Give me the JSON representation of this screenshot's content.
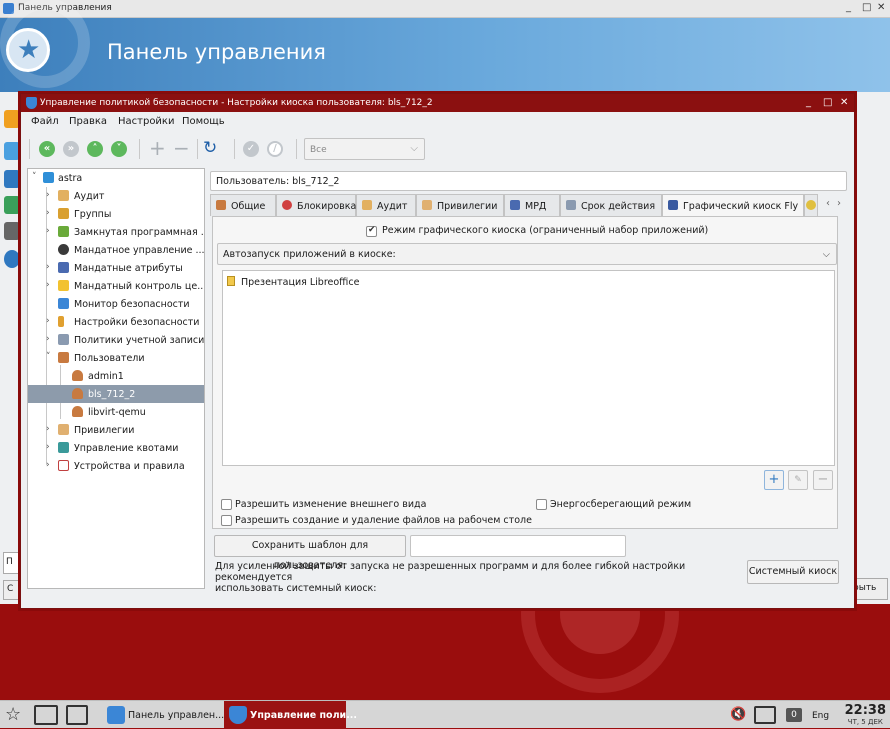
{
  "bg_window": {
    "title": "Панель управления",
    "header_title": "Панель управления",
    "search_fragment": "П",
    "left_button_fragment": "С",
    "open_button_fragment": "рыть"
  },
  "window": {
    "title": "Управление политикой безопасности - Настройки киоска пользователя: bls_712_2",
    "controls": [
      "_",
      "□",
      "✕"
    ]
  },
  "menu": [
    "Файл",
    "Правка",
    "Настройки",
    "Помощь"
  ],
  "toolbar": {
    "filter_value": "Все"
  },
  "tree": {
    "root": "astra",
    "items": [
      "Аудит",
      "Группы",
      "Замкнутая программная ...",
      "Мандатное управление ...",
      "Мандатные атрибуты",
      "Мандатный контроль це...",
      "Монитор безопасности",
      "Настройки безопасности",
      "Политики учетной записи",
      "Пользователи"
    ],
    "users": [
      "admin1",
      "bls_712_2",
      "libvirt-qemu"
    ],
    "after": [
      "Привилегии",
      "Управление квотами",
      "Устройства и правила"
    ]
  },
  "user_field": "Пользователь: bls_712_2",
  "tabs": [
    "Общие",
    "Блокировка",
    "Аудит",
    "Привилегии",
    "МРД",
    "Срок действия",
    "Графический киоск Fly"
  ],
  "kiosk": {
    "mode_label": "Режим графического киоска (ограниченный набор приложений)",
    "autostart_label": "Автозапуск приложений в киоске:",
    "apps": [
      "Презентация Libreoffice"
    ],
    "allow_appearance": "Разрешить изменение внешнего вида",
    "power_saving": "Энергосберегающий режим",
    "allow_files": "Разрешить создание и удаление файлов на рабочем столе"
  },
  "save_template_label": "Сохранить шаблон для пользователя:",
  "template_input_value": "",
  "note_line1": "Для усиленной защиты от запуска не разрешенных программ и для более гибкой настройки рекомендуется",
  "note_line2": "использовать системный киоск:",
  "system_kiosk_label": "Системный киоск",
  "taskbar": {
    "items": [
      "Панель управлен...",
      "Управление поли..."
    ],
    "tray_count": "0",
    "lang": "Eng",
    "time": "22:38",
    "date": "ЧТ, 5 ДЕК"
  },
  "colors": {
    "titlebar": "#8b1010",
    "desktop": "#9a0d0d",
    "selection": "#8d9bab",
    "toolbar_green": "#5db85d"
  }
}
